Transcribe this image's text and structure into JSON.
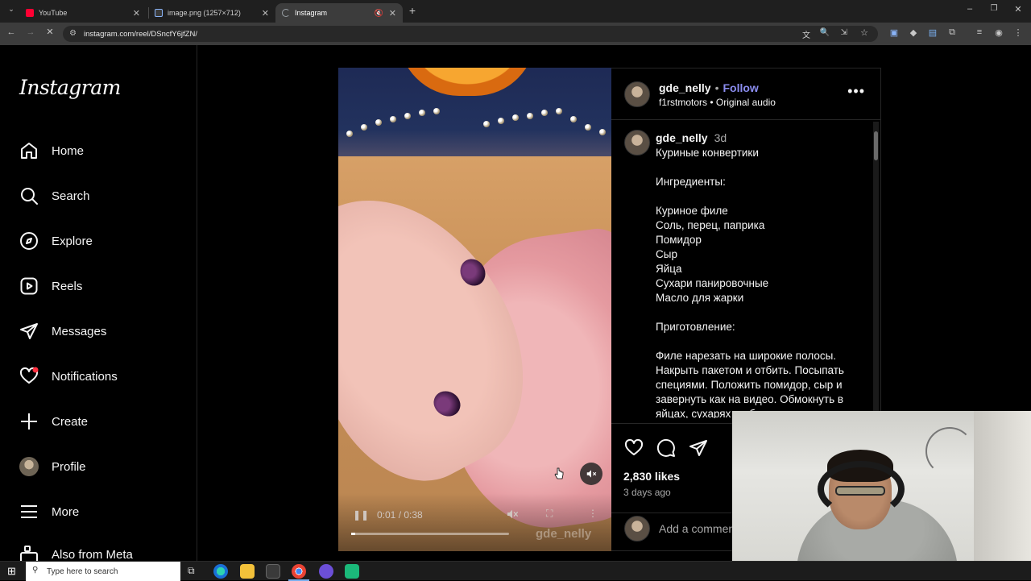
{
  "browser": {
    "tabs": [
      {
        "title": "YouTube",
        "icon": "youtube-icon",
        "color": "#ff0033"
      },
      {
        "title": "image.png (1257×712)",
        "icon": "image-icon",
        "color": "#8ab4f8"
      },
      {
        "title": "Instagram",
        "icon": "loading-icon",
        "color": "#9aa0a6",
        "active": true
      }
    ],
    "url": "instagram.com/reel/DSncfY6jfZN/"
  },
  "instagram": {
    "logo": "Instagram",
    "nav": [
      {
        "label": "Home",
        "icon": "home-icon"
      },
      {
        "label": "Search",
        "icon": "search-icon"
      },
      {
        "label": "Explore",
        "icon": "compass-icon"
      },
      {
        "label": "Reels",
        "icon": "reels-icon"
      },
      {
        "label": "Messages",
        "icon": "send-icon"
      },
      {
        "label": "Notifications",
        "icon": "heart-icon"
      },
      {
        "label": "Create",
        "icon": "plus-icon"
      },
      {
        "label": "Profile",
        "icon": "avatar"
      },
      {
        "label": "More",
        "icon": "menu-icon"
      },
      {
        "label": "Also from Meta",
        "icon": "meta-icon"
      }
    ],
    "post": {
      "username": "gde_nelly",
      "separator": "•",
      "follow_label": "Follow",
      "audio": "f1rstmotors • Original audio",
      "caption_user": "gde_nelly",
      "caption_age": "3d",
      "caption_text": "Куриные конвертики\n\nИнгредиенты:\n\nКуриное филе\nСоль, перец, паприка\nПомидор\nСыр\nЯйца\nСухари панировочные\nМасло для жарки\n\nПриготовление:\n\nФиле нарезать на широкие полосы. Накрыть пакетом и отбить. Посыпать специями. Положить помидор, сыр и завернуть как на видео. Обмокнуть в яйцах, сухарях и обжарить на",
      "likes": "2,830 likes",
      "posted": "3 days ago",
      "comment_placeholder": "Add a comment…"
    },
    "video": {
      "time": "0:01 / 0:38",
      "progress": 0.026,
      "watermark": "gde_nelly"
    }
  },
  "taskbar": {
    "search_placeholder": "Type here to search"
  }
}
